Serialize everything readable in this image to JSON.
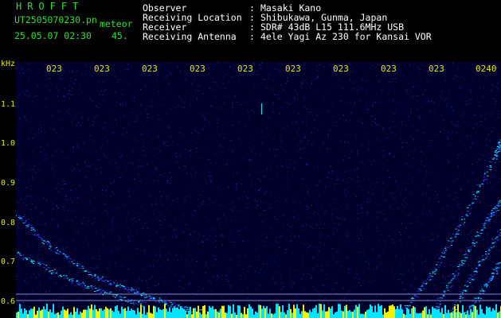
{
  "header": {
    "app_title": "HROFFT",
    "file_name": "UT2505070230.pn",
    "file_tag": "meteor",
    "date_time": "25.05.07 02:30",
    "stat_value": "45."
  },
  "meta": [
    {
      "label": "Observer",
      "value": "Masaki Kano"
    },
    {
      "label": "Receiving Location",
      "value": "Shibukawa, Gunma, Japan"
    },
    {
      "label": "Receiver",
      "value": "SDR# 43dB L15 111.6MHz USB"
    },
    {
      "label": "Receiving Antenna",
      "value": "4ele Yagi Az 230 for Kansai VOR"
    }
  ],
  "spectrogram": {
    "unit": "kHz",
    "y_ticks": [
      "1.1",
      "1.0",
      "0.9",
      "0.8",
      "0.7",
      "0.6"
    ],
    "x_ticks": [
      "023",
      "023",
      "023",
      "023",
      "023",
      "023",
      "023",
      "023",
      "023",
      "0240"
    ],
    "colors": {
      "background": "#00002a",
      "noise": "#2a3cff",
      "signal": "#00e5ff",
      "axis_text": "#e6e600",
      "header_green": "#2ee02e"
    }
  }
}
